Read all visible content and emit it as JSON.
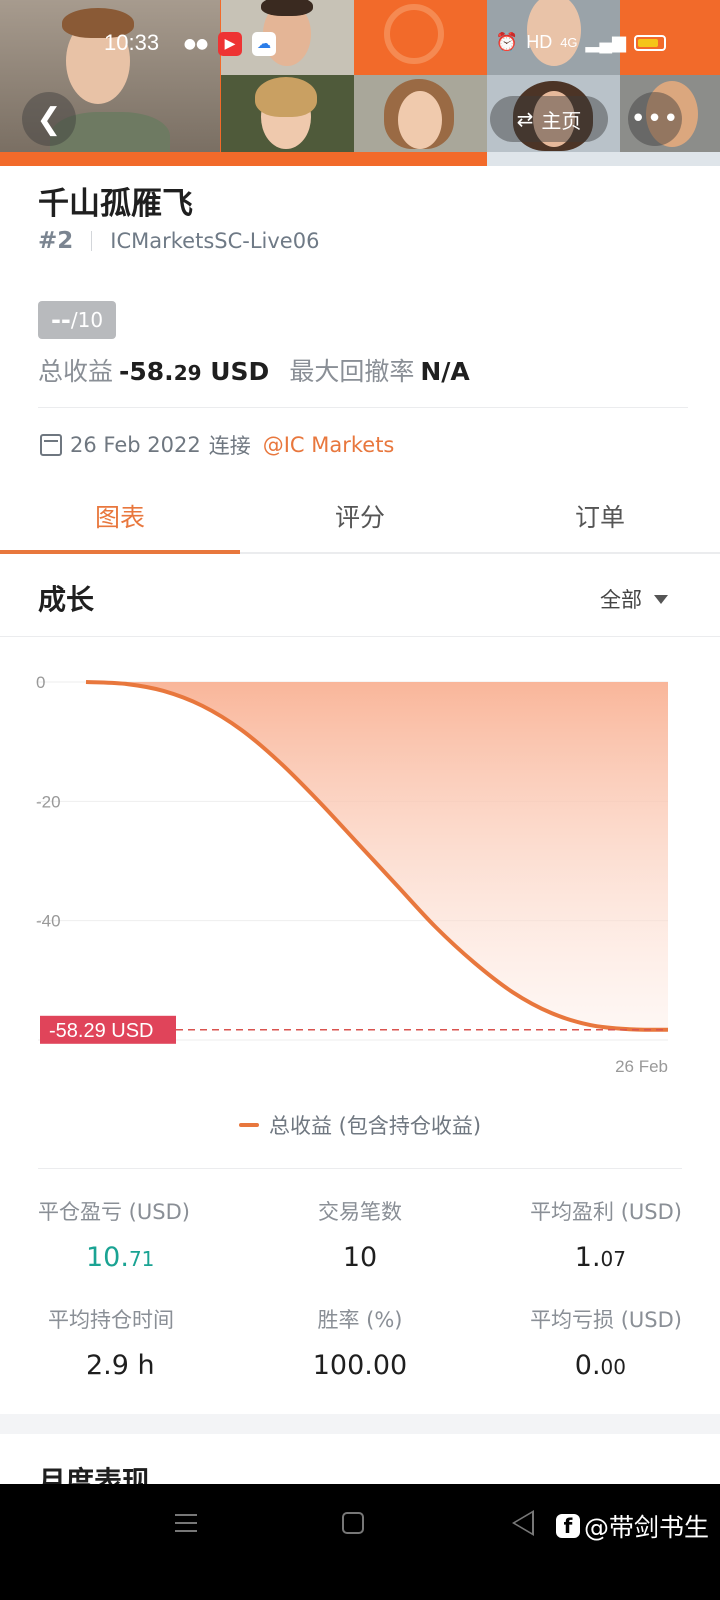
{
  "status_bar": {
    "time": "10:33",
    "network": "HD",
    "signal": "4G"
  },
  "header": {
    "back_icon": "chevron-left-icon",
    "home_label": "主页",
    "home_icon": "swap-arrows-icon",
    "more_icon": "ellipsis-icon"
  },
  "profile": {
    "name": "千山孤雁飞",
    "rank": "#2",
    "account": "ICMarketsSC-Live06",
    "score_value": "--",
    "score_max": "/10",
    "total_profit_label": "总收益",
    "total_profit_main": "-58.",
    "total_profit_decimal": "29",
    "total_profit_unit": "USD",
    "drawdown_label": "最大回撤率",
    "drawdown_value": "N/A",
    "connect_date": "26 Feb 2022",
    "connect_label": "连接",
    "broker": "@IC Markets"
  },
  "tabs": [
    {
      "label": "图表",
      "active": true
    },
    {
      "label": "评分",
      "active": false
    },
    {
      "label": "订单",
      "active": false
    }
  ],
  "growth": {
    "title": "成长",
    "filter": "全部"
  },
  "chart_data": {
    "type": "area",
    "title": "",
    "xlabel": "",
    "ylabel": "",
    "ylim": [
      -60,
      0
    ],
    "y_ticks": [
      "0",
      "-20",
      "-40"
    ],
    "x_tick_label": "26 Feb",
    "series": [
      {
        "name": "总收益 (包含持仓收益)",
        "values": [
          0,
          -0.3,
          -1.5,
          -4,
          -8,
          -13.5,
          -20,
          -27,
          -34,
          -41,
          -47,
          -52,
          -55.5,
          -57.5,
          -58.2,
          -58.29
        ]
      }
    ],
    "current_value_label": "-58.29 USD",
    "current_value": -58.29,
    "line_color": "#e8773d",
    "fill_color": "#f9b69a"
  },
  "legend": {
    "label": "总收益 (包含持仓收益)"
  },
  "stats": {
    "closed_pnl_label": "平仓盈亏 (USD)",
    "closed_pnl_main": "10.",
    "closed_pnl_decimal": "71",
    "trades_label": "交易笔数",
    "trades_value": "10",
    "avg_profit_label": "平均盈利 (USD)",
    "avg_profit_main": "1.",
    "avg_profit_decimal": "07",
    "avg_hold_label": "平均持仓时间",
    "avg_hold_value": "2.9 h",
    "win_rate_label": "胜率 (%)",
    "win_rate_value": "100.00",
    "avg_loss_label": "平均亏损 (USD)",
    "avg_loss_main": "0.",
    "avg_loss_decimal": "00"
  },
  "monthly": {
    "title": "月度表现"
  },
  "watermark": {
    "text": "@带剑书生"
  }
}
